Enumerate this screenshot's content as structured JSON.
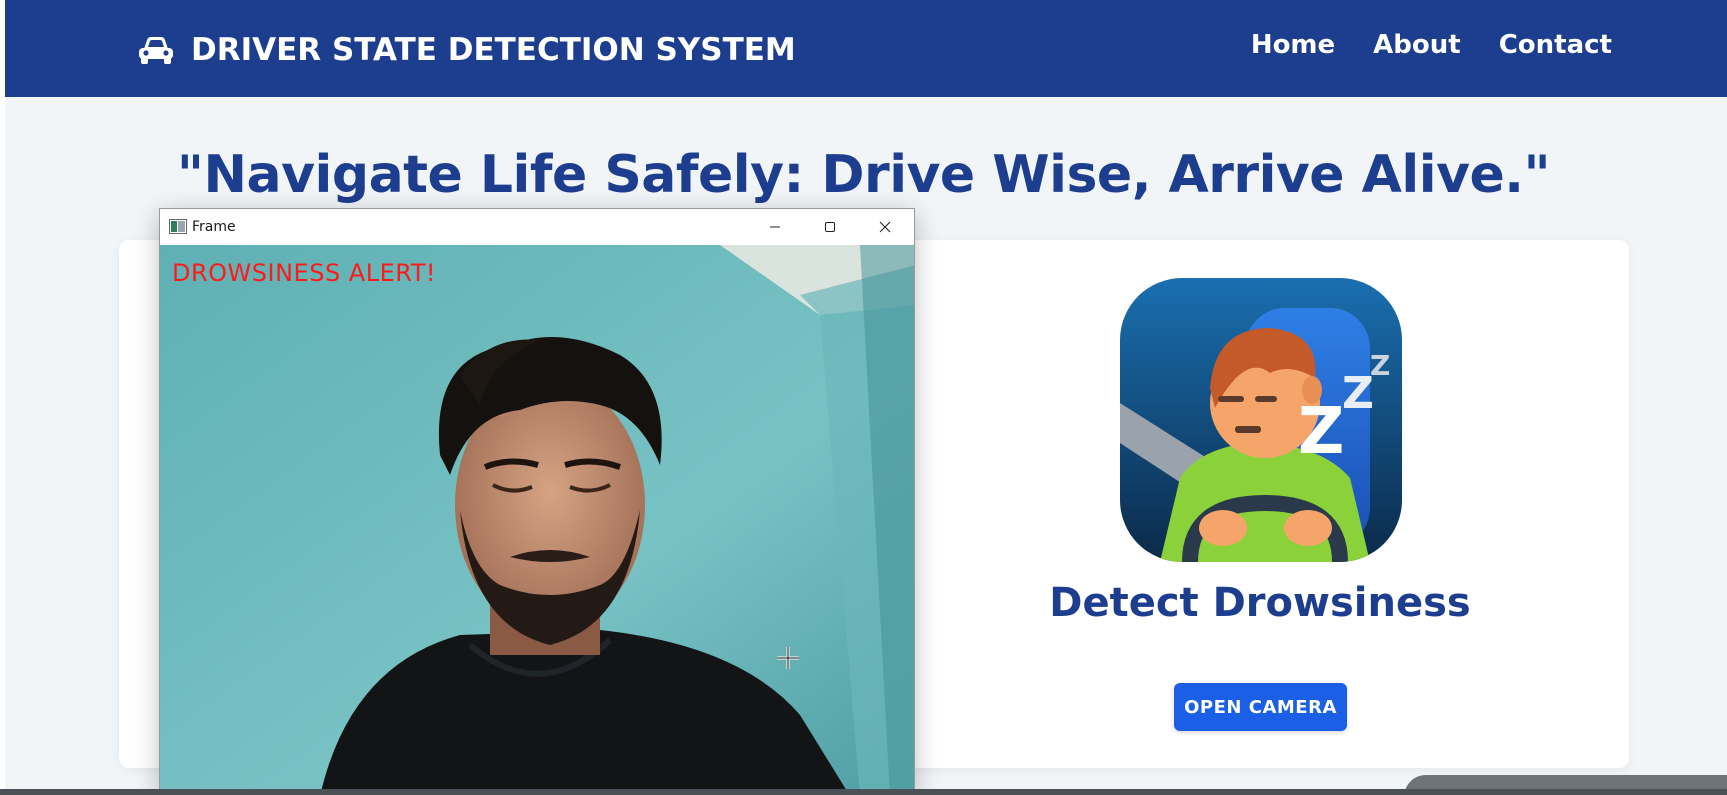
{
  "header": {
    "brand_title": "DRIVER STATE DETECTION SYSTEM",
    "brand_icon": "car-icon",
    "nav": [
      {
        "label": "Home"
      },
      {
        "label": "About"
      },
      {
        "label": "Contact"
      }
    ]
  },
  "hero": {
    "tagline": "\"Navigate Life Safely: Drive Wise, Arrive Alive.\""
  },
  "feature": {
    "title": "Detect Drowsiness",
    "button_label": "OPEN CAMERA",
    "logo_icon": "sleeping-driver-icon"
  },
  "camera_window": {
    "title": "Frame",
    "overlay_text": "DROWSINESS ALERT!",
    "controls": [
      "minimize-icon",
      "maximize-icon",
      "close-icon"
    ]
  },
  "colors": {
    "brand_blue": "#1d3d8f",
    "button_blue": "#1a5fe6",
    "alert_red": "#ff1a1a",
    "page_bg": "#f1f5f8"
  }
}
